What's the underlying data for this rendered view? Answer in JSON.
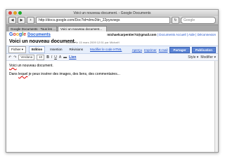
{
  "window": {
    "title": "Voici un nouveau document. - Google Documents"
  },
  "nav": {
    "url": "http://docs.google.com/Doc?id=dmv2ttn_22pysvwgs",
    "search_placeholder": "Google",
    "back_glyph": "◀",
    "forward_glyph": "▶",
    "add_glyph": "+",
    "reload_glyph": "↻",
    "close_glyph": "✕"
  },
  "tabs": [
    {
      "label": "Google Documents - Tous les ..."
    },
    {
      "label": "Voici un nouveau document..."
    }
  ],
  "header": {
    "account": "michaelcarpentier74@gmail.com",
    "link_docs": "Documents Accueil",
    "link_help": "Aide",
    "link_logout": "Déconnexion",
    "sep": "|",
    "logo_parts": [
      "G",
      "o",
      "o",
      "g",
      "l",
      "e"
    ],
    "docs_label": "Documents"
  },
  "doc": {
    "title": "Voici un nouveau document.",
    "modified": "modifié le 15 mars 2009 12:51 par Michaël"
  },
  "menu": {
    "file": "Fichier ▾",
    "edit": "Edition",
    "insert": "Insertion",
    "revisions": "Révisions",
    "html": "Modifier le code HTML",
    "preview": "Aperçu",
    "print": "Imprimer",
    "email": "E-mail",
    "share": "Partager",
    "publish": "Publication"
  },
  "toolbar": {
    "undo": "↶",
    "redo": "↷",
    "font": "Verdana",
    "size": "10",
    "bold": "B",
    "italic": "I",
    "underline": "U",
    "color": "A",
    "highlight": "▬",
    "link": "Lien",
    "style": "Style ▾",
    "modify": "Modifier ▾"
  },
  "content": {
    "line1_word": "Voici",
    "line1_rest": " un nouveau document.",
    "line2_a": "Dans ",
    "line2_b": "lequel",
    "line2_c": " je peux insérer des images, des liens, des commentaires..."
  },
  "colors": {
    "accent": "#1a4dc8",
    "menu_bg": "#e6eefb",
    "share_btn": "#5c84d4"
  }
}
